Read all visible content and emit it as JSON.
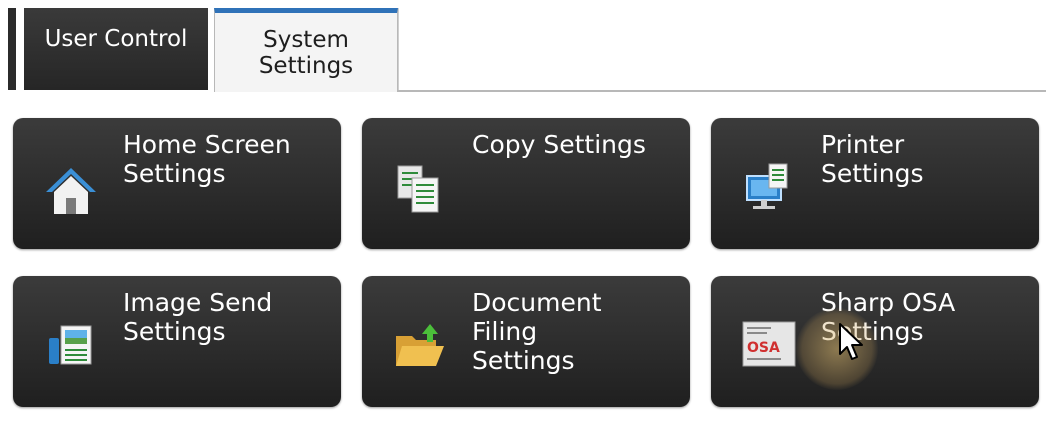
{
  "tabs": {
    "user_control": "User Control",
    "system_settings": "System\nSettings"
  },
  "tiles": [
    {
      "label": "Home Screen\nSettings",
      "icon": "home-icon"
    },
    {
      "label": "Copy Settings",
      "icon": "copy-icon"
    },
    {
      "label": "Printer\nSettings",
      "icon": "printer-icon"
    },
    {
      "label": "Image Send\nSettings",
      "icon": "image-send-icon"
    },
    {
      "label": "Document\nFiling\nSettings",
      "icon": "document-filing-icon"
    },
    {
      "label": "Sharp OSA\nSettings",
      "icon": "sharp-osa-icon"
    }
  ],
  "icon_texts": {
    "osa": "OSA"
  },
  "colors": {
    "tab_active_accent": "#2f72b8",
    "tile_bg": "#2c2c2c",
    "tile_text": "#ffffff"
  }
}
